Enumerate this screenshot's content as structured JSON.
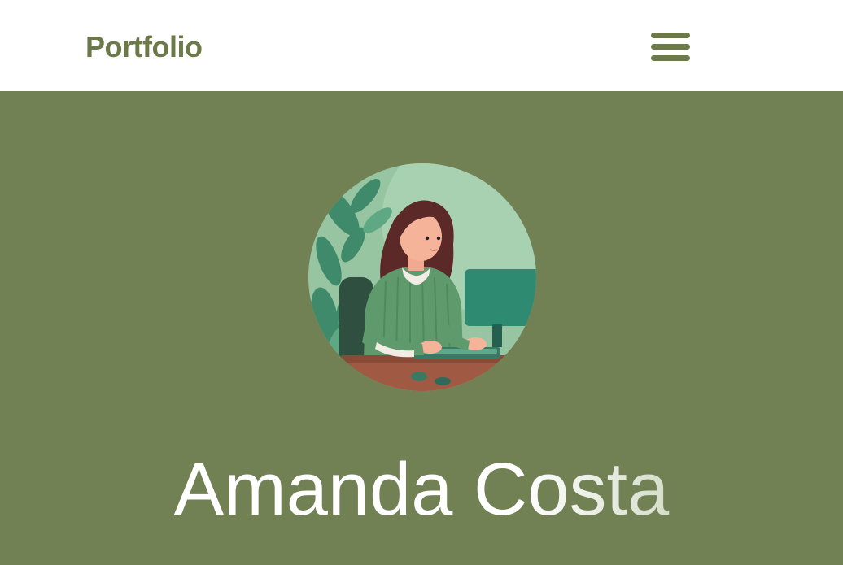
{
  "navbar": {
    "brand": "Portfolio",
    "menu_icon": "hamburger-menu-icon"
  },
  "hero": {
    "avatar_icon": "avatar-illustration",
    "name": "Amanda Costa"
  },
  "colors": {
    "primary": "#728153",
    "brand_text": "#6b7a48",
    "header_bg": "#ffffff",
    "hero_text": "#ffffff"
  }
}
